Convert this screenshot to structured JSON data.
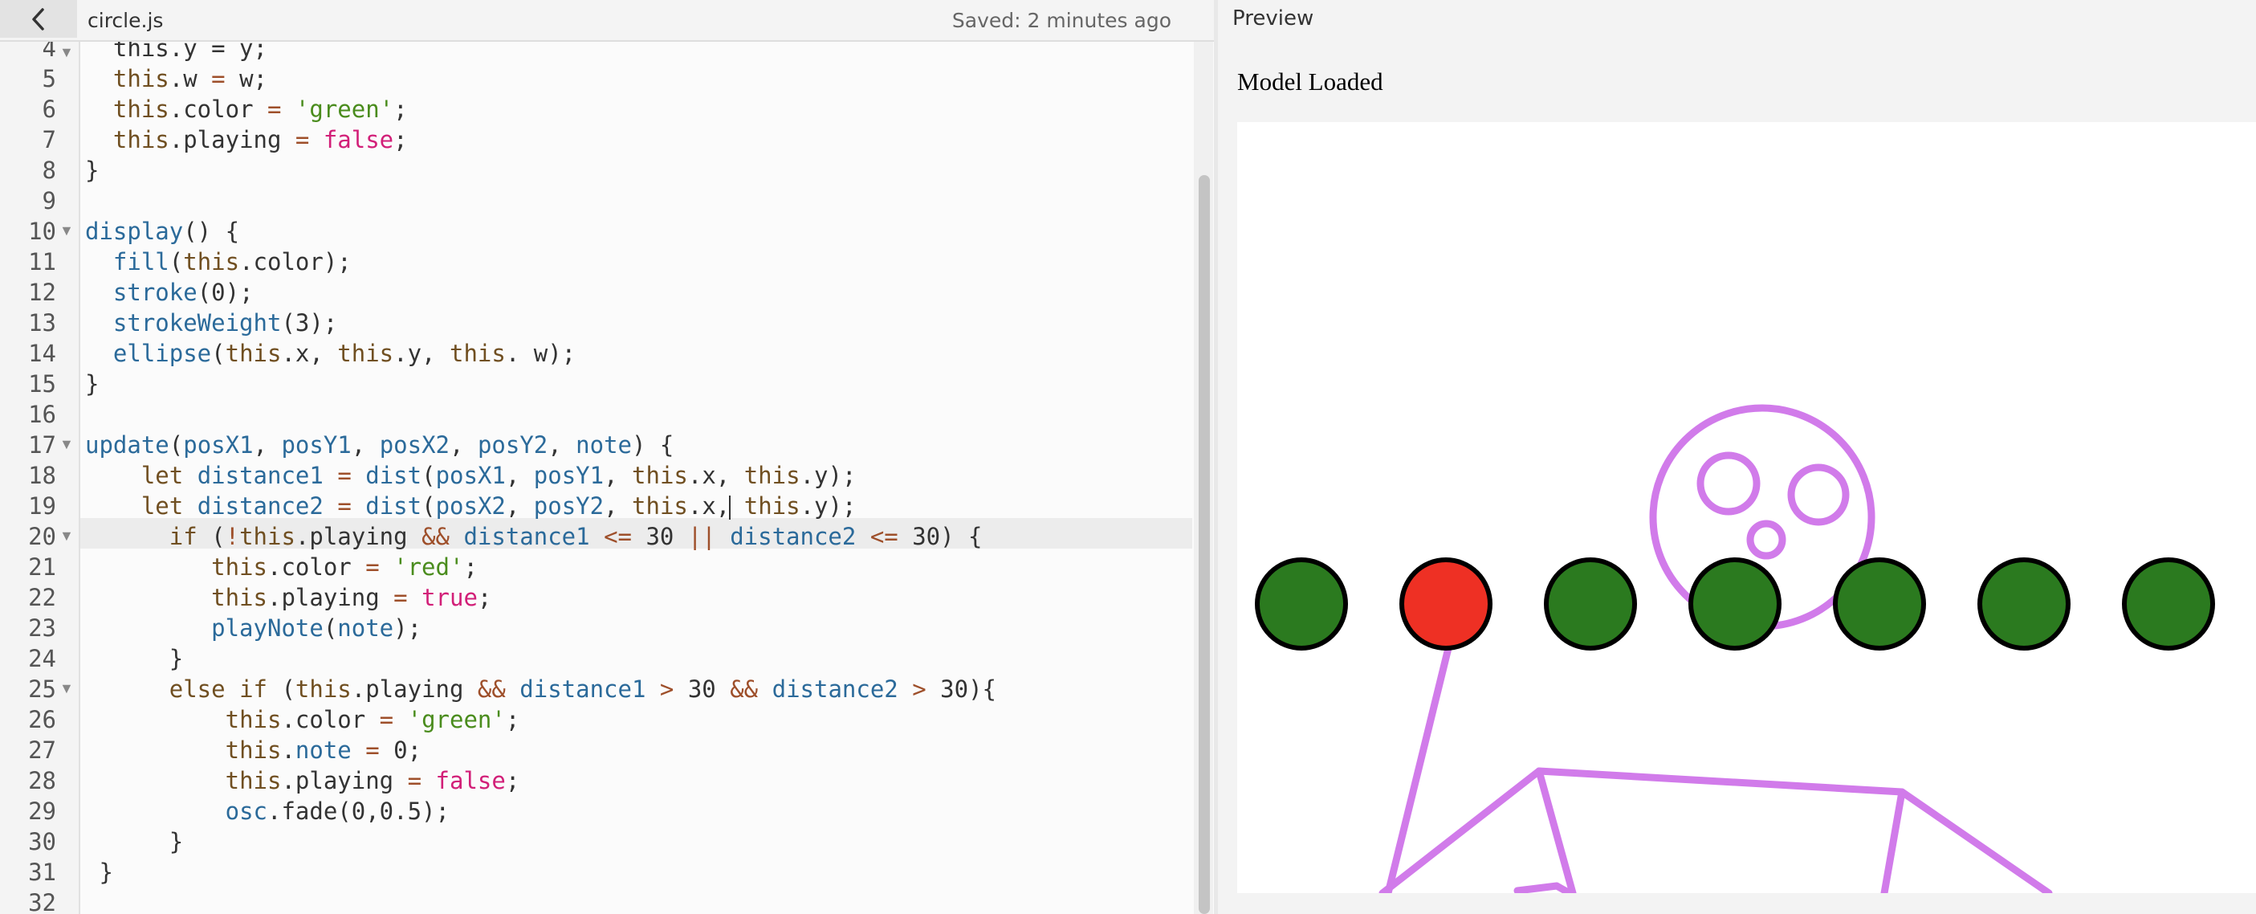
{
  "tab": {
    "filename": "circle.js",
    "saved": "Saved: 2 minutes ago"
  },
  "preview": {
    "label": "Preview",
    "status": "Model Loaded"
  },
  "code": [
    {
      "n": "5",
      "text": "  this.w = w;"
    },
    {
      "n": "6",
      "text": "  this.color = 'green';"
    },
    {
      "n": "7",
      "text": "  this.playing = false;"
    },
    {
      "n": "8",
      "text": "}"
    },
    {
      "n": "9",
      "text": ""
    },
    {
      "n": "10",
      "text": "display() {",
      "fold": true
    },
    {
      "n": "11",
      "text": "  fill(this.color);"
    },
    {
      "n": "12",
      "text": "  stroke(0);"
    },
    {
      "n": "13",
      "text": "  strokeWeight(3);"
    },
    {
      "n": "14",
      "text": "  ellipse(this.x, this.y, this. w);"
    },
    {
      "n": "15",
      "text": "}"
    },
    {
      "n": "16",
      "text": ""
    },
    {
      "n": "17",
      "text": "update(posX1, posY1, posX2, posY2, note) {",
      "fold": true
    },
    {
      "n": "18",
      "text": "    let distance1 = dist(posX1, posY1, this.x, this.y);"
    },
    {
      "n": "19",
      "text": "    let distance2 = dist(posX2, posY2, this.x, this.y);",
      "active": true
    },
    {
      "n": "20",
      "text": "      if (!this.playing && distance1 <= 30 || distance2 <= 30) {",
      "fold": true
    },
    {
      "n": "21",
      "text": "         this.color = 'red';"
    },
    {
      "n": "22",
      "text": "         this.playing = true;"
    },
    {
      "n": "23",
      "text": "         playNote(note);"
    },
    {
      "n": "24",
      "text": "      }"
    },
    {
      "n": "25",
      "text": "      else if (this.playing && distance1 > 30 && distance2 > 30){",
      "fold": true
    },
    {
      "n": "26",
      "text": "          this.color = 'green';"
    },
    {
      "n": "27",
      "text": "          this.note = 0;"
    },
    {
      "n": "28",
      "text": "          this.playing = false;"
    },
    {
      "n": "29",
      "text": "          osc.fade(0,0.5);"
    },
    {
      "n": "30",
      "text": "      }"
    },
    {
      "n": "31",
      "text": " }"
    },
    {
      "n": "32",
      "text": ""
    }
  ],
  "colors": {
    "circle_green": "#2b7a1f",
    "circle_red": "#ee3024",
    "skeleton": "#d17bea",
    "keyword": "#704f21",
    "function": "#2b6a9a",
    "string": "#4a8c1d",
    "boolean": "#d21f78"
  },
  "circles": [
    "green",
    "red",
    "green",
    "green",
    "green",
    "green",
    "green"
  ]
}
